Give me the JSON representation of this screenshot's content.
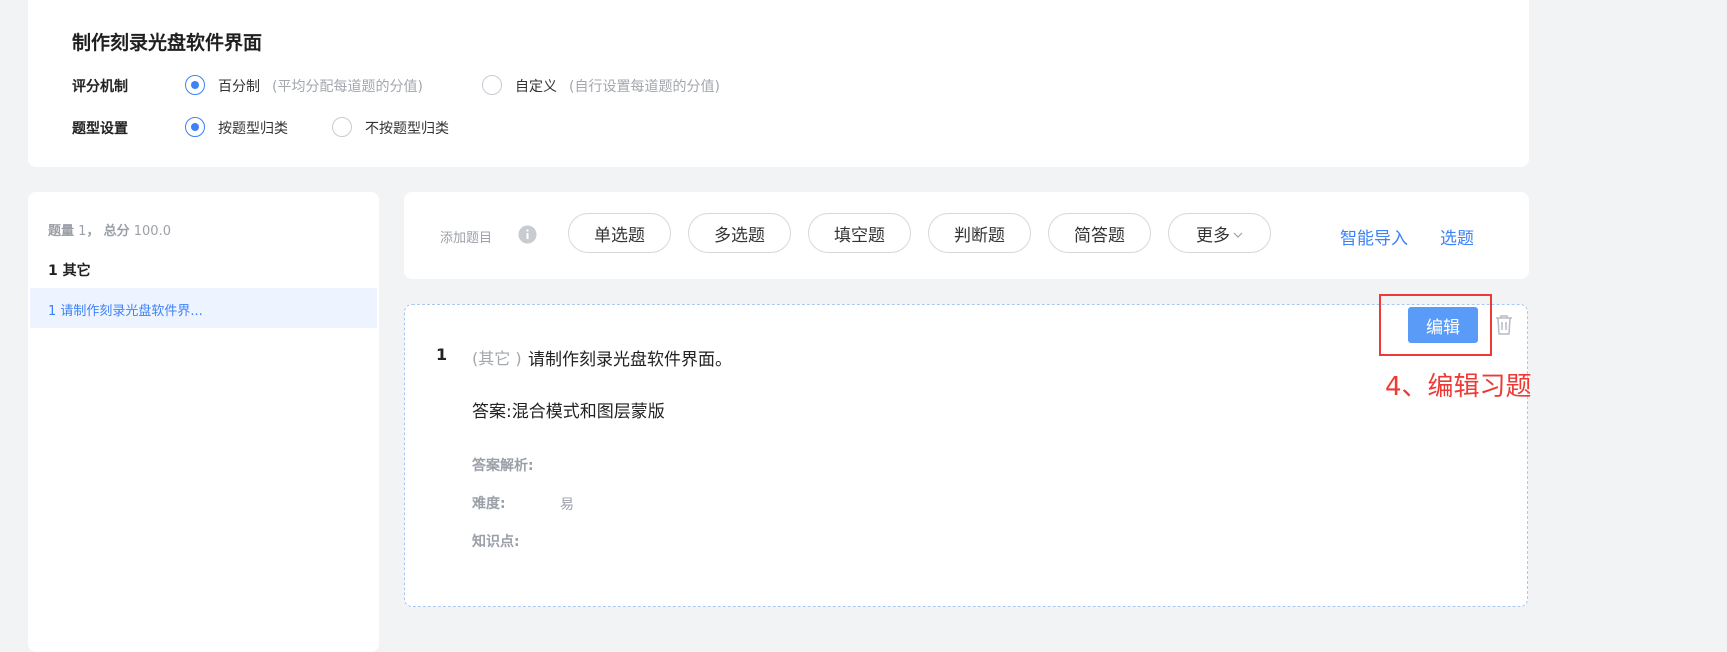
{
  "header": {
    "title": "制作刻录光盘软件界面",
    "scoring": {
      "label": "评分机制",
      "options": [
        {
          "label": "百分制",
          "hint": "(平均分配每道题的分值)",
          "selected": true
        },
        {
          "label": "自定义",
          "hint": "(自行设置每道题的分值)",
          "selected": false
        }
      ]
    },
    "type_setting": {
      "label": "题型设置",
      "options": [
        {
          "label": "按题型归类",
          "selected": true
        },
        {
          "label": "不按题型归类",
          "selected": false
        }
      ]
    }
  },
  "sidebar": {
    "count_label": "题量",
    "count_value": "1",
    "sep": "，",
    "total_label": "总分",
    "total_value": "100.0",
    "group_title": "1 其它",
    "items": [
      {
        "label": "1 请制作刻录光盘软件界...",
        "active": true
      }
    ]
  },
  "toolbar": {
    "add_label": "添加题目",
    "types": [
      "单选题",
      "多选题",
      "填空题",
      "判断题",
      "简答题"
    ],
    "more_label": "更多",
    "smart_import": "智能导入",
    "pick": "选题"
  },
  "question": {
    "number": "1",
    "category": "(其它 )",
    "text": "请制作刻录光盘软件界面。",
    "answer_label": "答案:",
    "answer_value": "混合模式和图层蒙版",
    "analysis_label": "答案解析:",
    "difficulty_label": "难度:",
    "difficulty_value": "易",
    "knowledge_label": "知识点:",
    "edit_button": "编辑"
  },
  "annotation": {
    "text": "4、编辑习题",
    "color": "#ee3a34"
  },
  "colors": {
    "accent": "#3e82f7",
    "edit_button_bg": "#5b9bf8",
    "background": "#f2f3f5"
  },
  "icons": [
    "info-icon",
    "chevron-down-icon",
    "trash-icon"
  ]
}
